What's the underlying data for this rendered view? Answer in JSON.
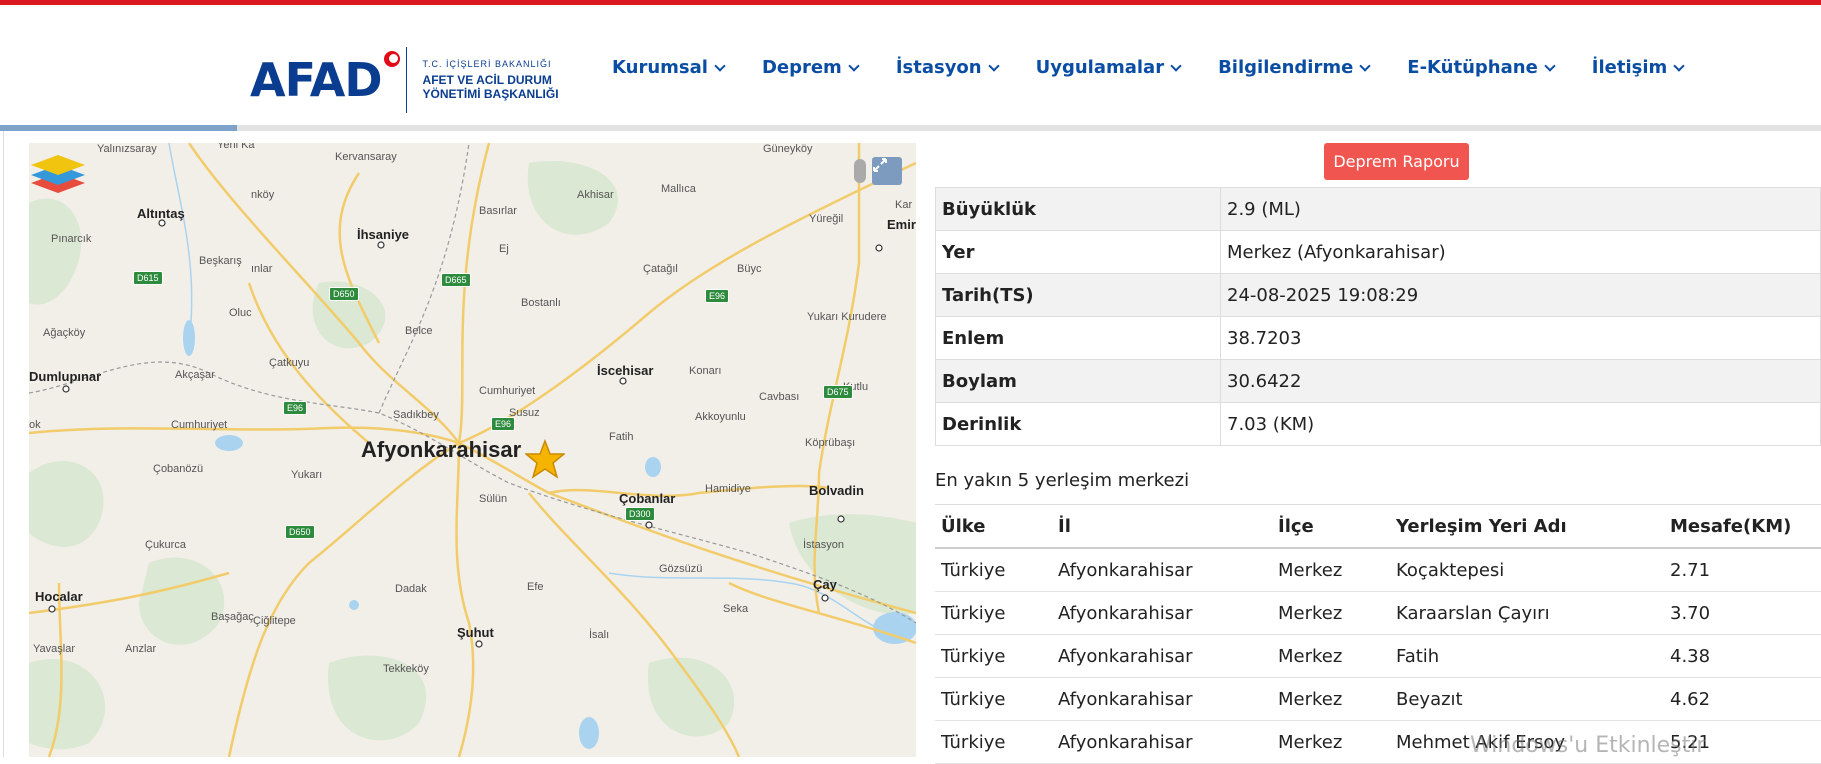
{
  "logo": {
    "mark": "AFAD",
    "line1": "T.C. İÇİŞLERİ BAKANLIĞI",
    "line2": "AFET VE ACİL DURUM",
    "line3": "YÖNETİMİ BAŞKANLIĞI"
  },
  "nav": [
    {
      "label": "Kurumsal"
    },
    {
      "label": "Deprem"
    },
    {
      "label": "İstasyon"
    },
    {
      "label": "Uygulamalar"
    },
    {
      "label": "Bilgilendirme"
    },
    {
      "label": "E-Kütüphane"
    },
    {
      "label": "İletişim"
    }
  ],
  "page_progress": 0.13,
  "map": {
    "labels": {
      "afyonkarahisar": "Afyonkarahisar",
      "altintas": "Altıntaş",
      "ihsaniye": "İhsaniye",
      "dumlupinar": "Dumlupınar",
      "iscehisar": "İscehisar",
      "bolvadin": "Bolvadin",
      "cobanlar": "Çobanlar",
      "hocalar": "Hocalar",
      "suhut": "Şuhut",
      "cay": "Çay",
      "emirdag": "Emir",
      "yalinizsaray": "Yalınızsaray",
      "yenika": "Yeni Ka",
      "kervansaray": "Kervansaray",
      "guneykoy": "Güneyköy",
      "mallica": "Mallıca",
      "akhisar": "Akhisar",
      "basirlar": "Basırlar",
      "ej": "Ej",
      "yuregil": "Yüreğil",
      "kara": "Kar",
      "pinarcik": "Pınarcık",
      "beskarıs": "Beşkarış",
      "inlar": "ınlar",
      "nkoy": "nköy",
      "catagil": "Çatağıl",
      "buyc": "Büyc",
      "bostanli": "Bostanlı",
      "oluc": "Oluc",
      "belce": "Belce",
      "yukan_kurudere": "Yukarı Kurudere",
      "agackoy": "Ağaçköy",
      "catkuyu": "Çatkuyu",
      "akcasar": "Akçaşar",
      "cumhuriyet1": "Cumhuriyet",
      "cumhuriyet2": "Cumhuriyet",
      "konari": "Konarı",
      "kutlu": "Kutlu",
      "cavbasi": "Cavbası",
      "sadikbey": "Sadıkbey",
      "susuz": "Susuz",
      "akkoyunlu": "Akkoyunlu",
      "ok": "ok",
      "fatih": "Fatih",
      "koprubasi": "Köprübaşı",
      "cobanozu": "Çobanözü",
      "yukari": "Yukarı",
      "sulun": "Sülün",
      "hamidiye": "Hamidiye",
      "istasyon": "İstasyon",
      "cukurca": "Çukurca",
      "gozsuzu": "Gözsüzü",
      "dadak": "Dadak",
      "efe": "Efe",
      "basagac": "Başağaç",
      "ciglitepe": "Çiğlitepe",
      "anzlar": "Anzlar",
      "seka": "Seka",
      "isali": "İsalı",
      "yavaslar": "Yavaşlar",
      "tekkekoy": "Tekkeköy"
    },
    "roads": {
      "d615": "D615",
      "d650a": "D650",
      "d665": "D665",
      "e96a": "E96",
      "e96b": "E96",
      "e96c": "E96",
      "d675": "D675",
      "d300": "D300",
      "d650b": "D650"
    },
    "expand_icon": "expand-icon",
    "layers_icon": "layers-icon",
    "epicenter_icon": "star-icon"
  },
  "report_button": "Deprem Raporu",
  "details": [
    {
      "key": "Büyüklük",
      "value": "2.9 (ML)"
    },
    {
      "key": "Yer",
      "value": "Merkez (Afyonkarahisar)"
    },
    {
      "key": "Tarih(TS)",
      "value": "24-08-2025 19:08:29"
    },
    {
      "key": "Enlem",
      "value": "38.7203"
    },
    {
      "key": "Boylam",
      "value": "30.6422"
    },
    {
      "key": "Derinlik",
      "value": "7.03 (KM)"
    }
  ],
  "nearest": {
    "title": "En yakın 5 yerleşim merkezi",
    "headers": [
      "Ülke",
      "İl",
      "İlçe",
      "Yerleşim Yeri Adı",
      "Mesafe(KM)"
    ],
    "rows": [
      [
        "Türkiye",
        "Afyonkarahisar",
        "Merkez",
        "Koçaktepesi",
        "2.71"
      ],
      [
        "Türkiye",
        "Afyonkarahisar",
        "Merkez",
        "Karaarslan Çayırı",
        "3.70"
      ],
      [
        "Türkiye",
        "Afyonkarahisar",
        "Merkez",
        "Fatih",
        "4.38"
      ],
      [
        "Türkiye",
        "Afyonkarahisar",
        "Merkez",
        "Beyazıt",
        "4.62"
      ],
      [
        "Türkiye",
        "Afyonkarahisar",
        "Merkez",
        "Mehmet Akif Ersoy",
        "5.21"
      ]
    ]
  },
  "watermark": "Windows'u Etkinleştir"
}
